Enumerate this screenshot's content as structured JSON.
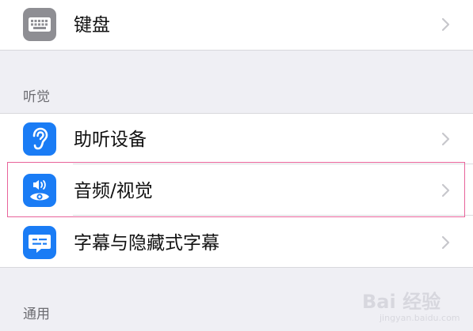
{
  "top_group": {
    "keyboard": {
      "label": "键盘",
      "icon": "keyboard-icon",
      "icon_bg": "#8e8e93"
    }
  },
  "hearing_section": {
    "header": "听觉",
    "items": [
      {
        "label": "助听设备",
        "icon": "ear-icon",
        "icon_bg": "#1a7cf5"
      },
      {
        "label": "音频/视觉",
        "icon": "speaker-eye-icon",
        "icon_bg": "#1a7cf5"
      },
      {
        "label": "字幕与隐藏式字幕",
        "icon": "caption-bubble-icon",
        "icon_bg": "#1a7cf5"
      }
    ]
  },
  "general_section": {
    "header": "通用"
  },
  "watermark": {
    "brand": "Bai 经验",
    "url": "jingyan.baidu.com"
  },
  "colors": {
    "background": "#efeff4",
    "highlight_border": "#e8639a",
    "chevron": "#c7c7cc"
  }
}
